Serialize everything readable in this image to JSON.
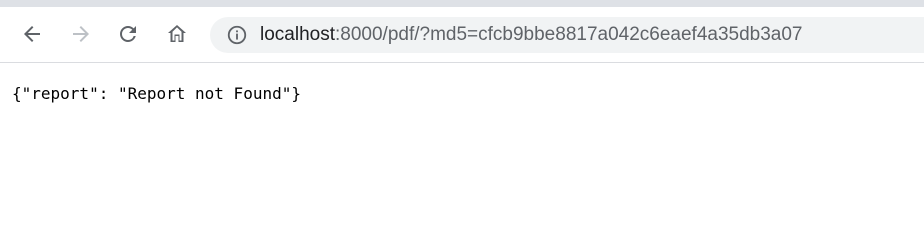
{
  "toolbar": {
    "back_icon": "back-arrow-icon",
    "forward_icon": "forward-arrow-icon",
    "reload_icon": "reload-icon",
    "home_icon": "home-icon"
  },
  "omnibox": {
    "security_icon": "info-icon",
    "url_host": "localhost",
    "url_rest": ":8000/pdf/?md5=cfcb9bbe8817a042c6eaef4a35db3a07"
  },
  "page": {
    "body_text": "{\"report\": \"Report not Found\"}"
  },
  "colors": {
    "tabstrip": "#dee1e6",
    "omnibox_bg": "#f1f3f4",
    "icon_active": "#5f6368",
    "icon_disabled": "#bdc1c6"
  }
}
